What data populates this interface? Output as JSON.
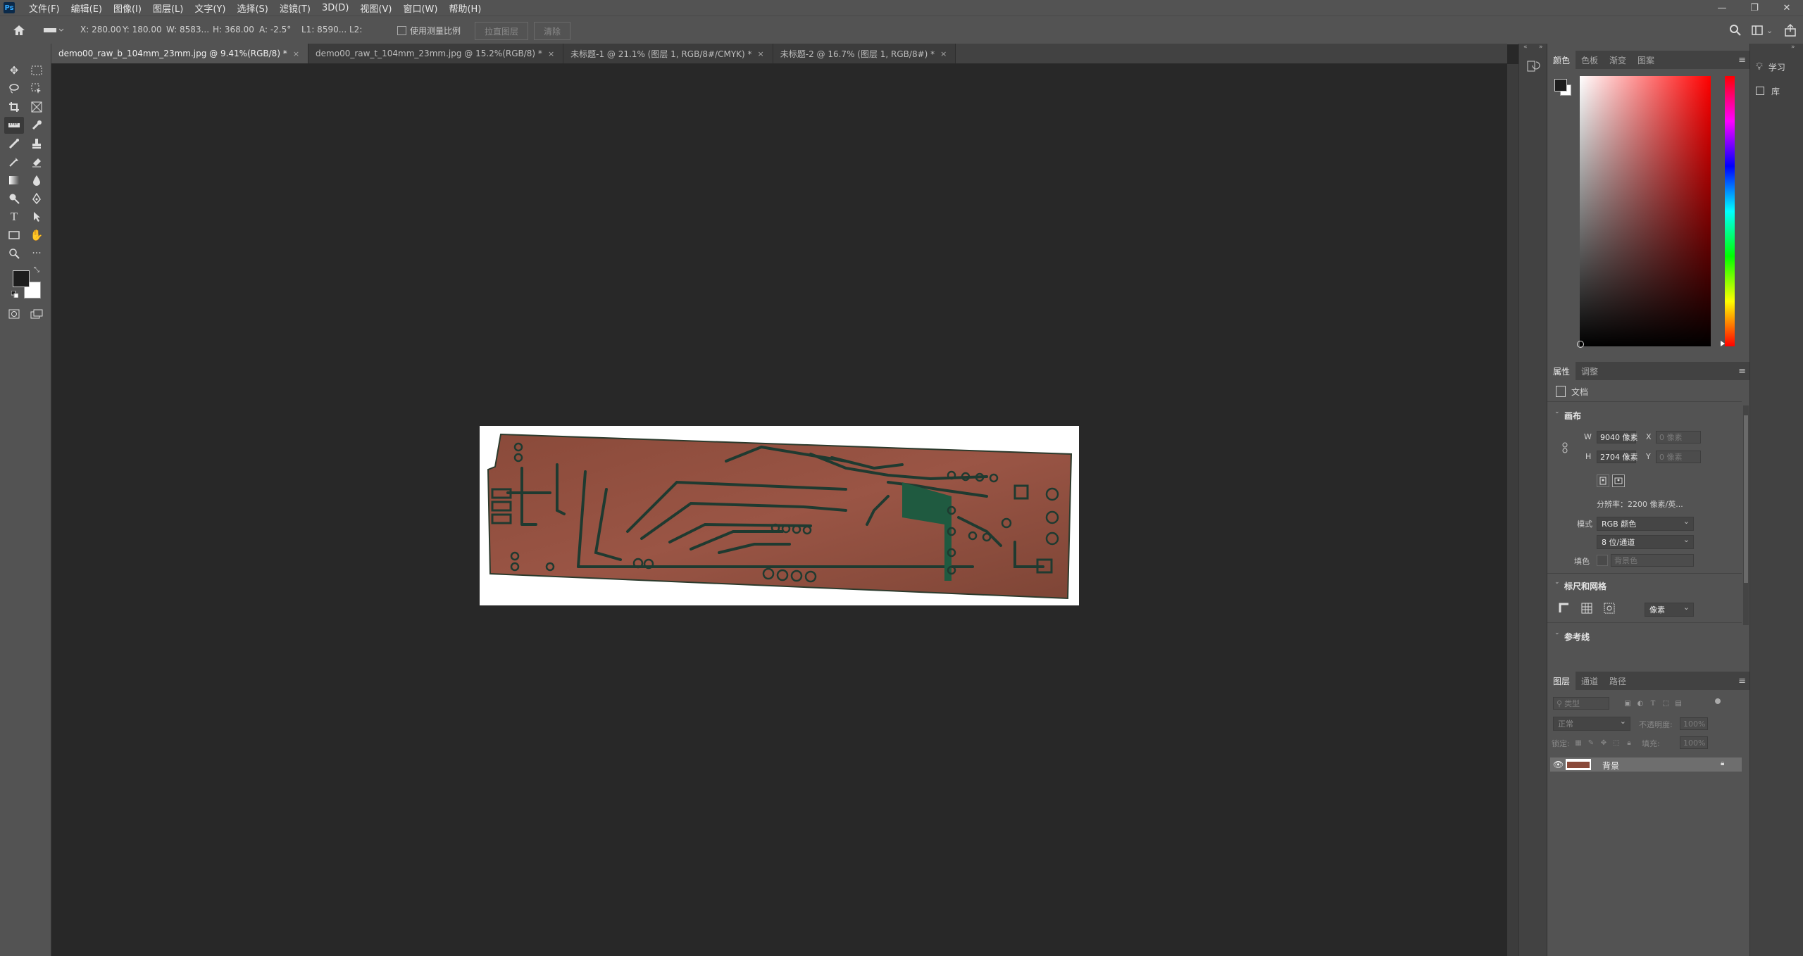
{
  "app": {
    "logo": "Ps",
    "menus": [
      "文件(F)",
      "编辑(E)",
      "图像(I)",
      "图层(L)",
      "文字(Y)",
      "选择(S)",
      "滤镜(T)",
      "3D(D)",
      "视图(V)",
      "窗口(W)",
      "帮助(H)"
    ],
    "window_controls": [
      "—",
      "❐",
      "✕"
    ]
  },
  "options": {
    "x": "X: 280.00",
    "y": "Y: 180.00",
    "w": "W: 8583...",
    "h": "H: 368.00",
    "a": "A: -2.5°",
    "l1": "L1: 8590...",
    "l2": "L2:",
    "use_scale_label": "使用测量比例",
    "straighten_label": "拉直图层",
    "clear_label": "清除"
  },
  "tabs": [
    {
      "label": "demo00_raw_b_104mm_23mm.jpg @ 9.41%(RGB/8) *",
      "close": "×"
    },
    {
      "label": "demo00_raw_t_104mm_23mm.jpg @ 15.2%(RGB/8) *",
      "close": "×"
    },
    {
      "label": "未标题-1 @ 21.1% (图层 1, RGB/8#/CMYK) *",
      "close": "×"
    },
    {
      "label": "未标题-2 @ 16.7% (图层 1, RGB/8#) *",
      "close": "×"
    }
  ],
  "color_panel": {
    "tabs": [
      "颜色",
      "色板",
      "渐变",
      "图案"
    ],
    "hue_color": "#ff0000"
  },
  "properties_panel": {
    "tabs": [
      "属性",
      "调整"
    ],
    "doc_label": "文档",
    "canvas_header": "画布",
    "w_label": "W",
    "w_value": "9040 像素",
    "h_label": "H",
    "h_value": "2704 像素",
    "x_label": "X",
    "x_placeholder": "0 像素",
    "y_label": "Y",
    "y_placeholder": "0 像素",
    "resolution": "分辨率：2200 像素/英...",
    "mode_label": "模式",
    "mode_value": "RGB 颜色",
    "depth_value": "8 位/通道",
    "fill_label": "填色",
    "fill_value": "背景色",
    "rulers_header": "标尺和网格",
    "units_value": "像素",
    "guides_header": "参考线"
  },
  "layers_panel": {
    "tabs": [
      "图层",
      "通道",
      "路径"
    ],
    "search_placeholder": "类型",
    "blend_mode": "正常",
    "opacity_label": "不透明度:",
    "opacity_value": "100%",
    "lock_label": "锁定:",
    "fill_label": "填充:",
    "fill_value": "100%",
    "layers": [
      {
        "name": "背景",
        "visible": true,
        "locked": true
      }
    ]
  },
  "right_dock": {
    "learn_label": "学习",
    "library_label": "库"
  }
}
